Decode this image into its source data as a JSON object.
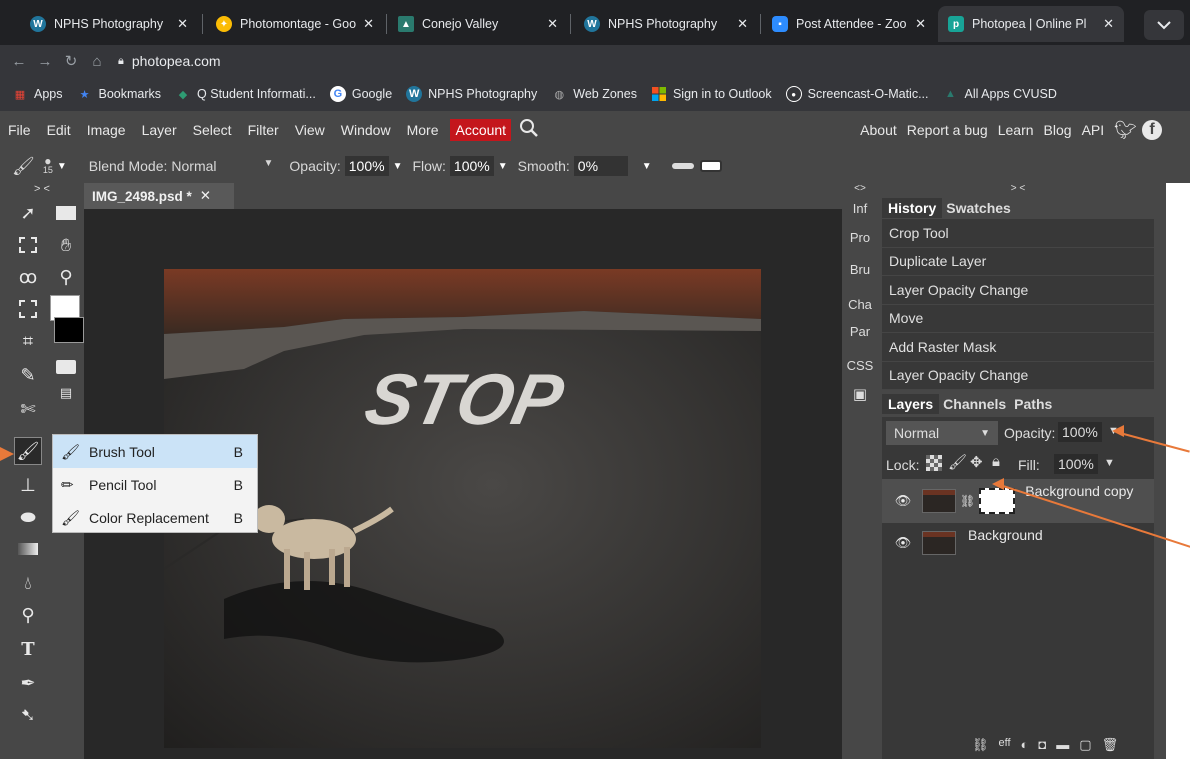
{
  "browser": {
    "tabs": [
      {
        "title": "NPHS Photography",
        "icon": "wordpress-icon"
      },
      {
        "title": "Photomontage - Goo",
        "icon": "google-photos-icon"
      },
      {
        "title": "Conejo Valley",
        "icon": "school-icon"
      },
      {
        "title": "NPHS Photography",
        "icon": "wordpress-icon"
      },
      {
        "title": "Post Attendee - Zoo",
        "icon": "zoom-icon"
      },
      {
        "title": "Photopea | Online Pl",
        "icon": "photopea-icon"
      }
    ],
    "tab_close": "✕",
    "url": "photopea.com",
    "bookmarks": [
      {
        "label": "Apps",
        "icon": "apps-grid-icon"
      },
      {
        "label": "Bookmarks",
        "icon": "star-icon"
      },
      {
        "label": "Q Student Informati...",
        "icon": "q-icon"
      },
      {
        "label": "Google",
        "icon": "google-icon"
      },
      {
        "label": "NPHS Photography",
        "icon": "wordpress-icon"
      },
      {
        "label": "Web Zones",
        "icon": "globe-icon"
      },
      {
        "label": "Sign in to Outlook",
        "icon": "microsoft-icon"
      },
      {
        "label": "Screencast-O-Matic...",
        "icon": "record-icon"
      },
      {
        "label": "All Apps CVUSD",
        "icon": "school-icon"
      }
    ]
  },
  "menubar": {
    "items": [
      "File",
      "Edit",
      "Image",
      "Layer",
      "Select",
      "Filter",
      "View",
      "Window",
      "More"
    ],
    "account": "Account",
    "right": [
      "About",
      "Report a bug",
      "Learn",
      "Blog",
      "API"
    ]
  },
  "options": {
    "brush_size": "15",
    "blend_label": "Blend Mode:",
    "blend_value": "Normal",
    "opacity_label": "Opacity:",
    "opacity_value": "100%",
    "flow_label": "Flow:",
    "flow_value": "100%",
    "smooth_label": "Smooth:",
    "smooth_value": "0%"
  },
  "document": {
    "tab_title": "IMG_2498.psd *",
    "tab_close": "✕",
    "photo_text": "STOP"
  },
  "flyout": {
    "items": [
      {
        "label": "Brush Tool",
        "key": "B"
      },
      {
        "label": "Pencil Tool",
        "key": "B"
      },
      {
        "label": "Color Replacement",
        "key": "B"
      }
    ]
  },
  "mini_panels": [
    "Inf",
    "Pro",
    "Bru",
    "Cha",
    "Par",
    "CSS"
  ],
  "collapse_left": "> <",
  "collapse_mini": "<>",
  "collapse_right": "> <",
  "history": {
    "tabs": [
      "History",
      "Swatches"
    ],
    "items": [
      "Crop Tool",
      "Duplicate Layer",
      "Layer Opacity Change",
      "Move",
      "Add Raster Mask",
      "Layer Opacity Change"
    ]
  },
  "layers": {
    "tabs": [
      "Layers",
      "Channels",
      "Paths"
    ],
    "blend": "Normal",
    "opacity_label": "Opacity:",
    "opacity_value": "100%",
    "lock_label": "Lock:",
    "fill_label": "Fill:",
    "fill_value": "100%",
    "list": [
      {
        "name": "Background copy",
        "has_mask": true,
        "selected": true
      },
      {
        "name": "Background",
        "has_mask": false,
        "selected": false
      }
    ],
    "footer": "eff"
  },
  "colors": {
    "accent": "#e8793a",
    "account": "#c4161c",
    "app_bg": "#474747",
    "panel_bg": "#383838"
  }
}
